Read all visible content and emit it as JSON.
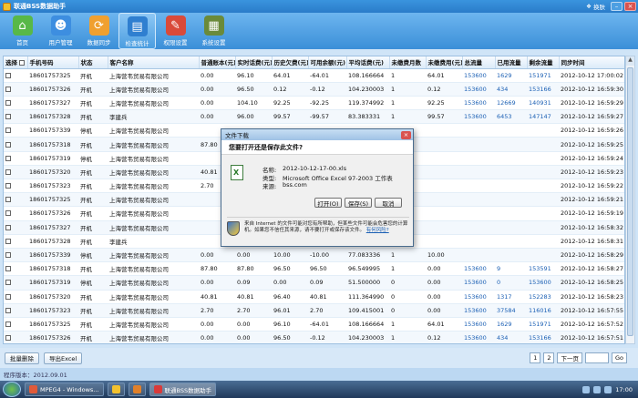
{
  "window": {
    "title": "联通BSS数据助手",
    "skin_label": "换肤"
  },
  "toolbar": [
    {
      "label": "首页",
      "icon": "home-icon",
      "glyph": "⌂",
      "color": "#58b848"
    },
    {
      "label": "用户管理",
      "icon": "user-icon",
      "glyph": "☻",
      "color": "#3d8ee0"
    },
    {
      "label": "数据同步",
      "icon": "sync-icon",
      "glyph": "⟳",
      "color": "#f0a030"
    },
    {
      "label": "检查统计",
      "icon": "monitor-icon",
      "glyph": "▤",
      "color": "#2f7fd0",
      "active": true
    },
    {
      "label": "权限设置",
      "icon": "lock-icon",
      "glyph": "✎",
      "color": "#d94a3a"
    },
    {
      "label": "系统设置",
      "icon": "settings-icon",
      "glyph": "▦",
      "color": "#6a8a3a"
    }
  ],
  "table": {
    "headers": [
      "选择",
      "手机号码",
      "状态",
      "客户名称",
      "普通账本(元)",
      "实时话费(元)",
      "历史欠费(元)",
      "可用余额(元)",
      "平均话费(元)",
      "未缴费月数",
      "未缴费用(元)",
      "总流量",
      "已用流量",
      "剩余流量",
      "同步时间"
    ],
    "rows": [
      [
        "18601757325",
        "开机",
        "上海营韦贸易有限公司",
        "0.00",
        "96.10",
        "64.01",
        "-64.01",
        "108.166664",
        "1",
        "64.01",
        "153600",
        "1629",
        "151971",
        "2012-10-12 17:00:02"
      ],
      [
        "18601757326",
        "开机",
        "上海营韦贸易有限公司",
        "0.00",
        "96.50",
        "0.12",
        "-0.12",
        "104.230003",
        "1",
        "0.12",
        "153600",
        "434",
        "153166",
        "2012-10-12 16:59:30"
      ],
      [
        "18601757327",
        "开机",
        "上海营韦贸易有限公司",
        "0.00",
        "104.10",
        "92.25",
        "-92.25",
        "119.374992",
        "1",
        "92.25",
        "153600",
        "12669",
        "140931",
        "2012-10-12 16:59:29"
      ],
      [
        "18601757328",
        "开机",
        "李建兵",
        "0.00",
        "96.00",
        "99.57",
        "-99.57",
        "83.383331",
        "1",
        "99.57",
        "153600",
        "6453",
        "147147",
        "2012-10-12 16:59:27"
      ],
      [
        "18601757339",
        "停机",
        "上海营韦贸易有限公司",
        "",
        "",
        "",
        "",
        "",
        "",
        "",
        "",
        "",
        "",
        "2012-10-12 16:59:26"
      ],
      [
        "18601757318",
        "开机",
        "上海营韦贸易有限公司",
        "87.80",
        "",
        "",
        "",
        "",
        "",
        "",
        "",
        "",
        "",
        "2012-10-12 16:59:25"
      ],
      [
        "18601757319",
        "停机",
        "上海营韦贸易有限公司",
        "",
        "",
        "",
        "",
        "",
        "",
        "",
        "",
        "",
        "",
        "2012-10-12 16:59:24"
      ],
      [
        "18601757320",
        "开机",
        "上海营韦贸易有限公司",
        "40.81",
        "",
        "",
        "",
        "",
        "",
        "",
        "",
        "",
        "",
        "2012-10-12 16:59:23"
      ],
      [
        "18601757323",
        "开机",
        "上海营韦贸易有限公司",
        "2.70",
        "",
        "",
        "",
        "",
        "",
        "",
        "",
        "",
        "",
        "2012-10-12 16:59:22"
      ],
      [
        "18601757325",
        "开机",
        "上海营韦贸易有限公司",
        "",
        "",
        "",
        "",
        "",
        "",
        "",
        "",
        "",
        "",
        "2012-10-12 16:59:21"
      ],
      [
        "18601757326",
        "开机",
        "上海营韦贸易有限公司",
        "",
        "",
        "",
        "",
        "",
        "",
        "",
        "",
        "",
        "",
        "2012-10-12 16:59:19"
      ],
      [
        "18601757327",
        "开机",
        "上海营韦贸易有限公司",
        "",
        "",
        "",
        "",
        "",
        "",
        "",
        "",
        "",
        "",
        "2012-10-12 16:58:32"
      ],
      [
        "18601757328",
        "开机",
        "李建兵",
        "",
        "",
        "",
        "",
        "",
        "",
        "",
        "",
        "",
        "",
        "2012-10-12 16:58:31"
      ],
      [
        "18601757339",
        "停机",
        "上海营韦贸易有限公司",
        "0.00",
        "0.00",
        "10.00",
        "-10.00",
        "77.083336",
        "1",
        "10.00",
        "",
        "",
        "",
        "2012-10-12 16:58:29"
      ],
      [
        "18601757318",
        "开机",
        "上海营韦贸易有限公司",
        "87.80",
        "87.80",
        "96.50",
        "96.50",
        "96.549995",
        "1",
        "0.00",
        "153600",
        "9",
        "153591",
        "2012-10-12 16:58:27"
      ],
      [
        "18601757319",
        "停机",
        "上海营韦贸易有限公司",
        "0.00",
        "0.09",
        "0.00",
        "0.09",
        "51.500000",
        "0",
        "0.00",
        "153600",
        "0",
        "153600",
        "2012-10-12 16:58:25"
      ],
      [
        "18601757320",
        "开机",
        "上海营韦贸易有限公司",
        "40.81",
        "40.81",
        "96.40",
        "40.81",
        "111.364990",
        "0",
        "0.00",
        "153600",
        "1317",
        "152283",
        "2012-10-12 16:58:23"
      ],
      [
        "18601757323",
        "开机",
        "上海营韦贸易有限公司",
        "2.70",
        "2.70",
        "96.01",
        "2.70",
        "109.415001",
        "0",
        "0.00",
        "153600",
        "37584",
        "116016",
        "2012-10-12 16:57:55"
      ],
      [
        "18601757325",
        "开机",
        "上海营韦贸易有限公司",
        "0.00",
        "0.00",
        "96.10",
        "-64.01",
        "108.166664",
        "1",
        "64.01",
        "153600",
        "1629",
        "151971",
        "2012-10-12 16:57:52"
      ],
      [
        "18601757326",
        "开机",
        "上海营韦贸易有限公司",
        "0.00",
        "0.00",
        "96.50",
        "-0.12",
        "104.230003",
        "1",
        "0.12",
        "153600",
        "434",
        "153166",
        "2012-10-12 16:57:51"
      ]
    ]
  },
  "footer": {
    "batch_delete": "批量删除",
    "export_excel": "导出Excel",
    "page_current": "1",
    "page_input": "2",
    "next_page": "下一页",
    "go": "Go"
  },
  "status": {
    "version": "程序版本：2012.09.01"
  },
  "taskbar": {
    "items": [
      {
        "label": "MPEG4 - Windows...",
        "color": "#e05a3a"
      },
      {
        "label": "",
        "color": "#f2c12e"
      },
      {
        "label": "",
        "color": "#e0802a"
      },
      {
        "label": "联通BSS数据助手",
        "color": "#d93a3a",
        "active": true
      }
    ],
    "clock": "17:00"
  },
  "dialog": {
    "title": "文件下载",
    "question": "您要打开还是保存此文件?",
    "name_label": "名称:",
    "name_value": "2012-10-12-17-00.xls",
    "type_label": "类型:",
    "type_value": "Microsoft Office Excel 97-2003 工作表",
    "source_label": "来源:",
    "source_value": "bss.com",
    "open_button": "打开(O)",
    "save_button": "保存(S)",
    "cancel_button": "取消",
    "warning_text": "来自 Internet 的文件可能对您有所帮助，但某些文件可能会危害您的计算机。如果您不信任其来源，请不要打开或保存该文件。",
    "warning_link": "有何风险?"
  }
}
